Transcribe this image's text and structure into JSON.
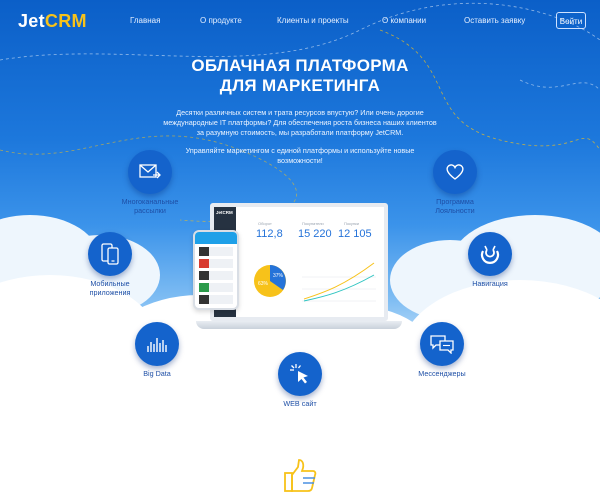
{
  "logo": {
    "part1": "Jet",
    "part2": "CRM"
  },
  "nav": {
    "items": [
      "Главная",
      "О продукте",
      "Клиенты и проекты",
      "О компании",
      "Оставить заявку"
    ],
    "login": "Войти"
  },
  "hero": {
    "title_line1": "ОБЛАЧНАЯ ПЛАТФОРМА",
    "title_line2": "ДЛЯ МАРКЕТИНГА",
    "description": "Десятки различных систем и трата ресурсов впустую? Или очень дорогие международные IT платформы? Для обеспечения роста бизнеса наших клиентов за разумную стоимость, мы разработали платформу JetCRM.",
    "subtext": "Управляйте маркетингом с единой платформы и используйте новые возможности!"
  },
  "features": {
    "mailing": {
      "label_line1": "Многоканальные",
      "label_line2": "рассылки",
      "icon": "envelope-send-icon"
    },
    "loyalty": {
      "label_line1": "Программа",
      "label_line2": "Лояльности",
      "icon": "heart-icon"
    },
    "mobile": {
      "label_line1": "Мобильные",
      "label_line2": "приложения",
      "icon": "mobile-devices-icon"
    },
    "navigation": {
      "label_line1": "Навигация",
      "icon": "navigation-icon"
    },
    "bigdata": {
      "label_line1": "Big Data",
      "icon": "bar-chart-icon"
    },
    "messengers": {
      "label_line1": "Мессенджеры",
      "icon": "chat-bubbles-icon"
    },
    "web": {
      "label_line1": "WEB сайт",
      "icon": "cursor-click-icon"
    }
  },
  "dashboard": {
    "logo": "JetCRM",
    "stats": [
      {
        "label": "Оборот",
        "value": "112,8"
      },
      {
        "label": "Покупатели",
        "value": "15 220"
      },
      {
        "label": "Покупки",
        "value": "12 105"
      }
    ],
    "pie_labels": [
      "63%",
      "37%"
    ]
  },
  "colors": {
    "accent_yellow": "#f7c21a",
    "circle_blue": "#1463cc",
    "sky_top": "#0b5fc8"
  }
}
